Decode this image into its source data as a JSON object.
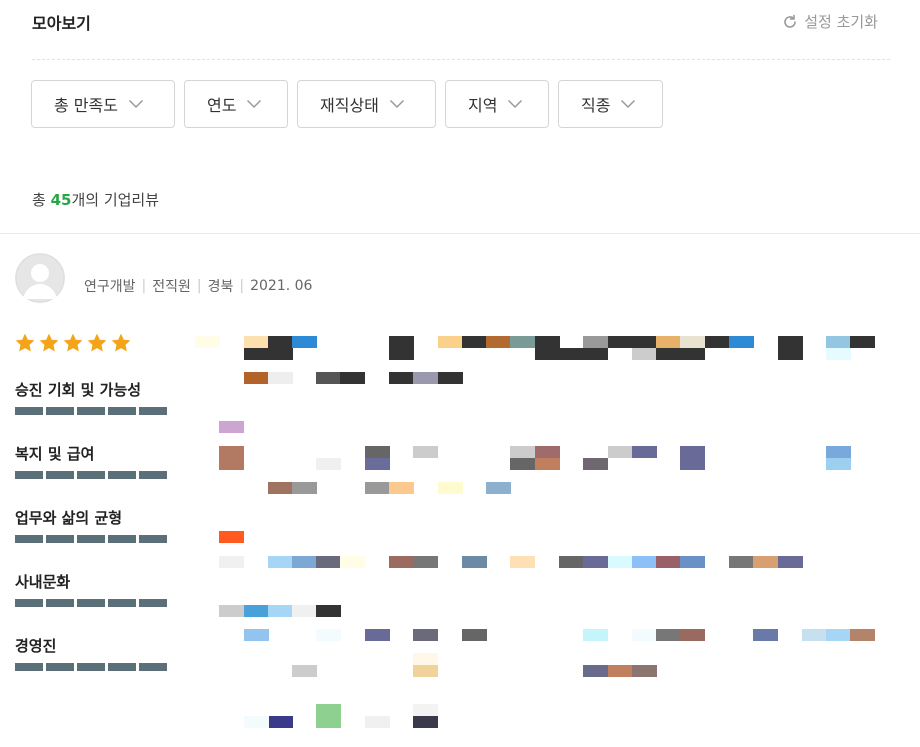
{
  "header": {
    "title": "모아보기",
    "reset_label": "설정 초기화"
  },
  "filters": [
    {
      "label": "총 만족도"
    },
    {
      "label": "연도"
    },
    {
      "label": "재직상태"
    },
    {
      "label": "지역"
    },
    {
      "label": "직종"
    }
  ],
  "summary": {
    "prefix": "총 ",
    "count": "45",
    "suffix": "개의 기업리뷰"
  },
  "review": {
    "meta": [
      "연구개발",
      "전직원",
      "경북",
      "2021. 06"
    ],
    "overall_rating": 5,
    "star_color": "#f5a31a",
    "categories": [
      {
        "name": "승진 기회 및 가능성",
        "rating": 5
      },
      {
        "name": "복지 및 급여",
        "rating": 5
      },
      {
        "name": "업무와 삶의 균형",
        "rating": 5
      },
      {
        "name": "사내문화",
        "rating": 5
      },
      {
        "name": "경영진",
        "rating": 5
      }
    ]
  },
  "colors": {
    "accent_green": "#2aa545",
    "rating_bar": "#5a6f78"
  }
}
